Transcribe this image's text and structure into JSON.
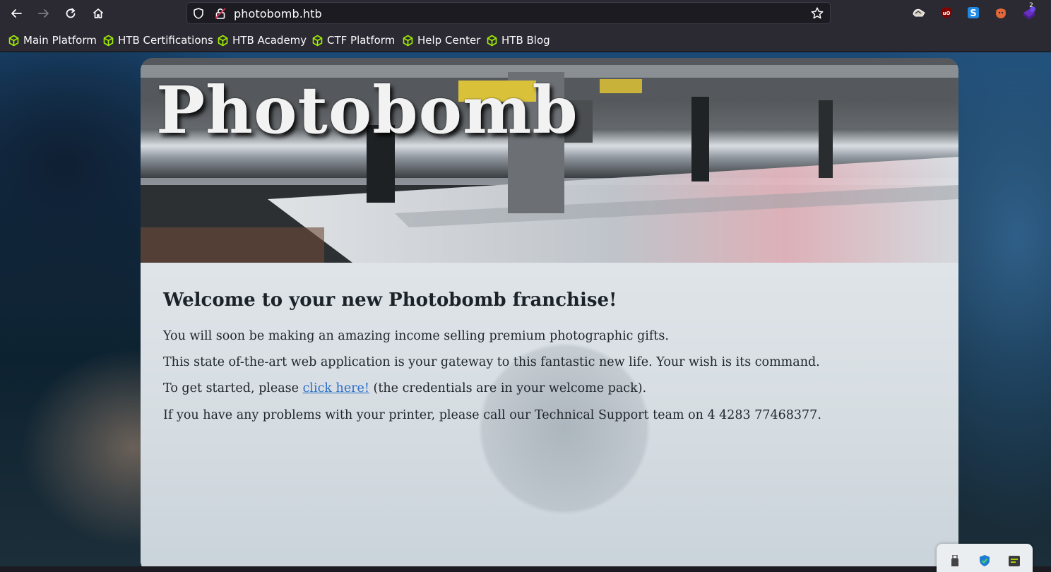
{
  "browser": {
    "url": "photobomb.htb",
    "nav_icons": [
      "back-arrow-icon",
      "forward-arrow-icon",
      "reload-icon",
      "home-icon"
    ],
    "extensions": [
      {
        "name": "wappalyzer-extension-icon"
      },
      {
        "name": "ublock-origin-extension-icon"
      },
      {
        "name": "s-extension-icon"
      },
      {
        "name": "foxyproxy-extension-icon"
      },
      {
        "name": "hackbar-extension-icon",
        "badge": "2"
      }
    ]
  },
  "bookmarks": [
    {
      "label": "Main Platform"
    },
    {
      "label": "HTB Certifications"
    },
    {
      "label": "HTB Academy"
    },
    {
      "label": "CTF Platform"
    },
    {
      "label": "Help Center"
    },
    {
      "label": "HTB Blog"
    }
  ],
  "page": {
    "hero_title": "Photobomb",
    "heading": "Welcome to your new Photobomb franchise!",
    "para1": "You will soon be making an amazing income selling premium photographic gifts.",
    "para2": "This state of-the-art web application is your gateway to this fantastic new life. Your wish is its command.",
    "para3_before": "To get started, please ",
    "para3_link": "click here!",
    "para3_after": " (the credentials are in your welcome pack).",
    "para4": "If you have any problems with your printer, please call our Technical Support team on 4 4283 77468377."
  },
  "colors": {
    "toolbar_bg": "#2b2a33",
    "bookmark_icon": "#9fef00",
    "link": "#2b6fc7"
  }
}
